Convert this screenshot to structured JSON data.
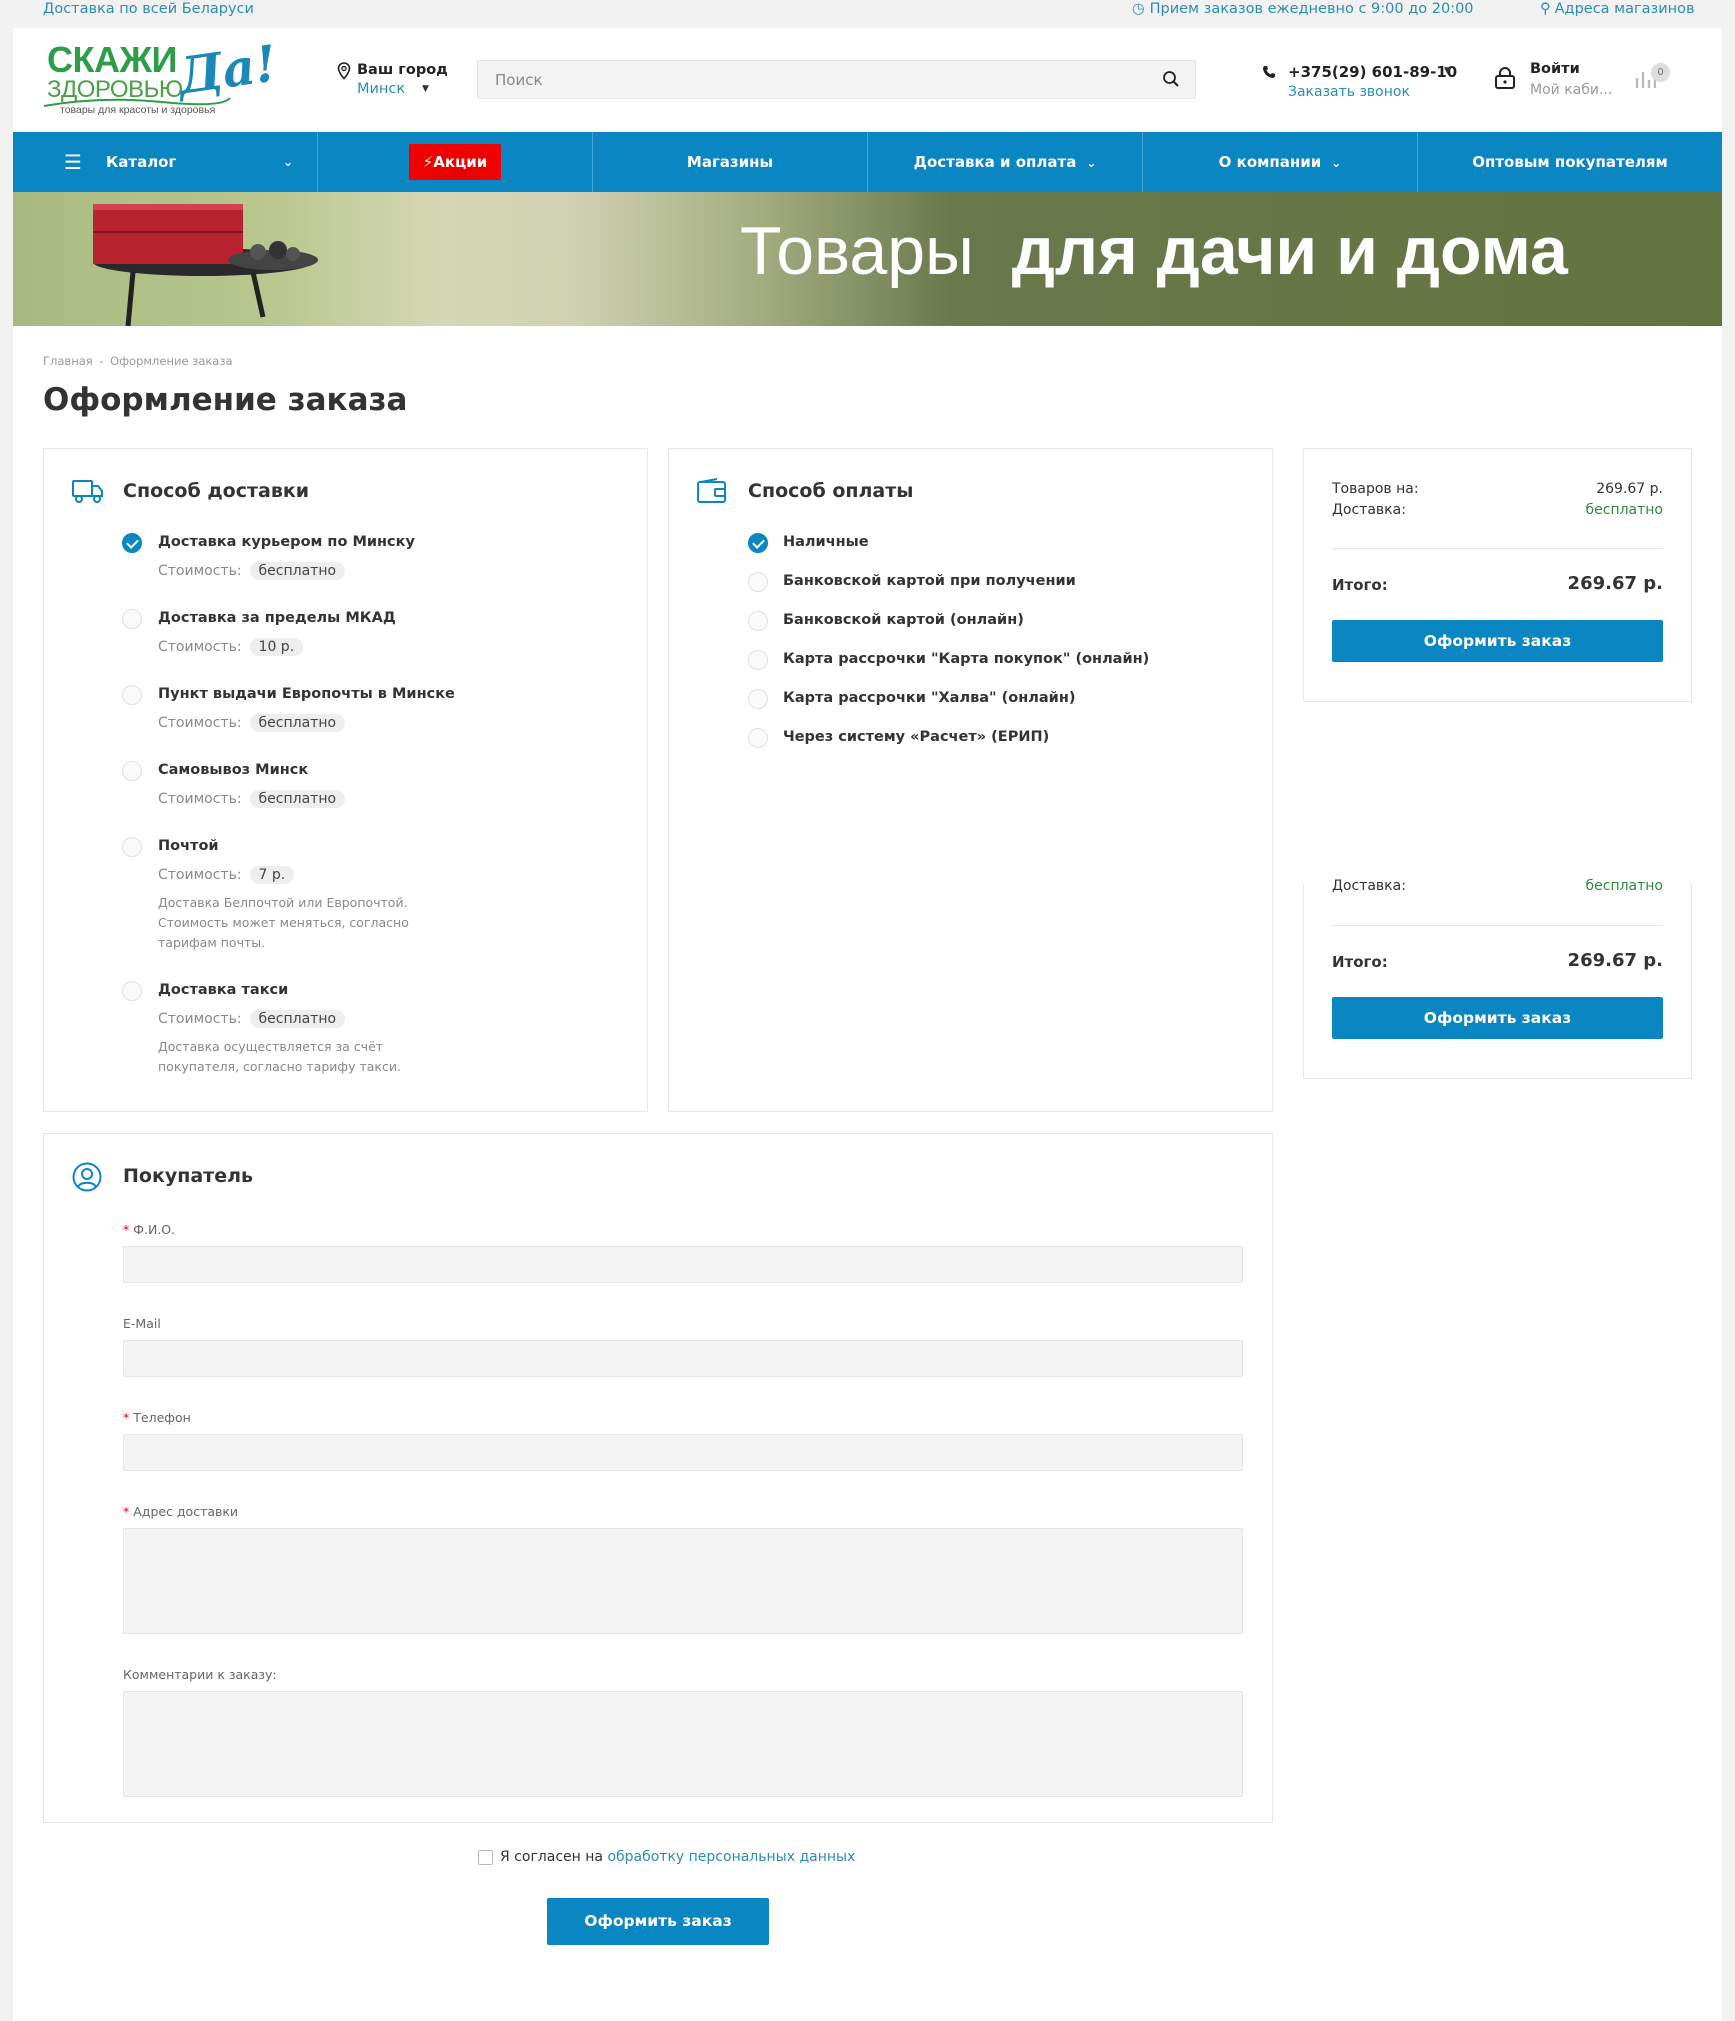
{
  "topbar": {
    "delivery": "Доставка по всей Беларуси",
    "hours": "Прием заказов ежедневно с 9:00 до 20:00",
    "stores": "Адреса магазинов"
  },
  "header": {
    "logo_line1": "СКАЖИ",
    "logo_line2": "ЗДОРОВЬЮ",
    "logo_da": "Да!",
    "logo_tagline": "товары для красоты и здоровья",
    "city_label": "Ваш город",
    "city_value": "Минск",
    "search_placeholder": "Поиск",
    "phone": "+375(29) 601-89-10",
    "callback": "Заказать звонок",
    "login": "Войти",
    "cabinet": "Мой каби...",
    "compare_count": "0"
  },
  "nav": {
    "catalog": "Каталог",
    "promo": "Акции",
    "stores": "Магазины",
    "delivery": "Доставка и оплата",
    "about": "О компании",
    "wholesale": "Оптовым покупателям"
  },
  "banner": {
    "text_light": "Товары",
    "text_bold": "для дачи и дома"
  },
  "breadcrumbs": {
    "home": "Главная",
    "sep": "-",
    "current": "Оформление заказа"
  },
  "page_title": "Оформление заказа",
  "delivery": {
    "title": "Способ доставки",
    "cost_label": "Стоимость:",
    "options": [
      {
        "name": "Доставка курьером по Минску",
        "cost": "бесплатно",
        "selected": true,
        "note": ""
      },
      {
        "name": "Доставка за пределы МКАД",
        "cost": "10 р.",
        "selected": false,
        "note": ""
      },
      {
        "name": "Пункт выдачи Европочты в Минске",
        "cost": "бесплатно",
        "selected": false,
        "note": ""
      },
      {
        "name": "Самовывоз Минск",
        "cost": "бесплатно",
        "selected": false,
        "note": ""
      },
      {
        "name": "Почтой",
        "cost": "7 р.",
        "selected": false,
        "note": "Доставка Белпочтой или Европочтой. Стоимость может меняться, согласно тарифам почты."
      },
      {
        "name": "Доставка такси",
        "cost": "бесплатно",
        "selected": false,
        "note": "Доставка осуществляется за счёт покупателя, согласно тарифу такси."
      }
    ]
  },
  "payment": {
    "title": "Способ оплаты",
    "options": [
      {
        "name": "Наличные",
        "selected": true
      },
      {
        "name": "Банковской картой при получении",
        "selected": false
      },
      {
        "name": "Банковской картой (онлайн)",
        "selected": false
      },
      {
        "name": "Карта рассрочки \"Карта покупок\" (онлайн)",
        "selected": false
      },
      {
        "name": "Карта рассрочки \"Халва\" (онлайн)",
        "selected": false
      },
      {
        "name": "Через систему «Расчет» (ЕРИП)",
        "selected": false
      }
    ]
  },
  "summary": {
    "goods_label": "Товаров на:",
    "goods_value": "269.67 р.",
    "delivery_label": "Доставка:",
    "delivery_value": "бесплатно",
    "total_label": "Итого:",
    "total_value": "269.67 р.",
    "submit": "Оформить заказ"
  },
  "buyer": {
    "title": "Покупатель",
    "fio_label": "Ф.И.О.",
    "email_label": "E-Mail",
    "phone_label": "Телефон",
    "address_label": "Адрес доставки",
    "comment_label": "Комментарии к заказу:",
    "required_mark": "*"
  },
  "consent": {
    "text": "Я согласен на",
    "link": "обработку персональных данных"
  },
  "submit_main": "Оформить заказ",
  "colors": {
    "accent": "#0a86c2",
    "promo": "#ee0000",
    "free": "#2e8b3e"
  }
}
